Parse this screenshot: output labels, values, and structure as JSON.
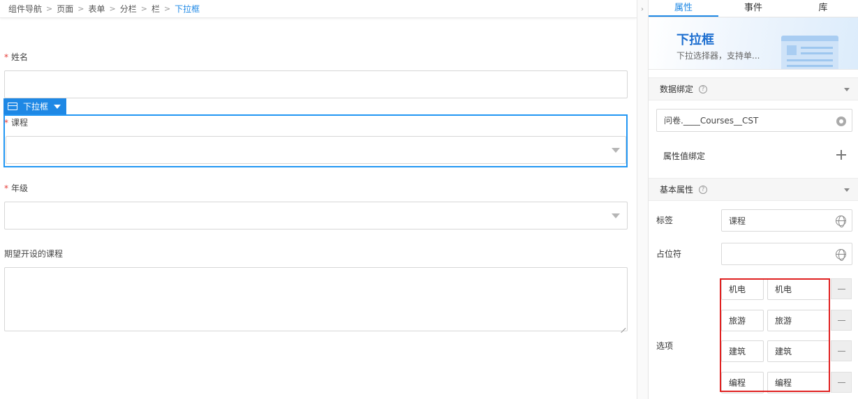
{
  "breadcrumb": {
    "items": [
      "组件导航",
      "页面",
      "表单",
      "分栏",
      "栏"
    ],
    "current": "下拉框",
    "separator": ">"
  },
  "form": {
    "required_mark": "*",
    "name_label": "姓名",
    "selected_component": "下拉框",
    "course_label": "课程",
    "grade_label": "年级",
    "expected_course_label": "期望开设的课程"
  },
  "panel": {
    "tabs": [
      {
        "label": "属性",
        "active": true
      },
      {
        "label": "事件",
        "active": false
      },
      {
        "label": "库",
        "active": false
      }
    ],
    "hero": {
      "title": "下拉框",
      "description": "下拉选择器，支持单..."
    },
    "data_binding": {
      "title": "数据绑定",
      "help": "?",
      "binding_value": "问卷.____Courses__CST",
      "attr_binding_label": "属性值绑定"
    },
    "basic": {
      "title": "基本属性",
      "help": "?",
      "label_label": "标签",
      "label_value": "课程",
      "placeholder_label": "占位符",
      "placeholder_value": "",
      "options_label": "选项",
      "options": [
        {
          "label": "机电",
          "value": "机电"
        },
        {
          "label": "旅游",
          "value": "旅游"
        },
        {
          "label": "建筑",
          "value": "建筑"
        },
        {
          "label": "编程",
          "value": "编程"
        }
      ]
    }
  },
  "colors": {
    "accent": "#1e88e5",
    "required": "#e53935",
    "highlight_box": "#e02020"
  },
  "icons": [
    "chevron-right-icon",
    "dropdown-caret-icon",
    "select-component-icon",
    "help-icon",
    "gear-icon",
    "globe-icon",
    "plus-icon",
    "minus-icon"
  ]
}
